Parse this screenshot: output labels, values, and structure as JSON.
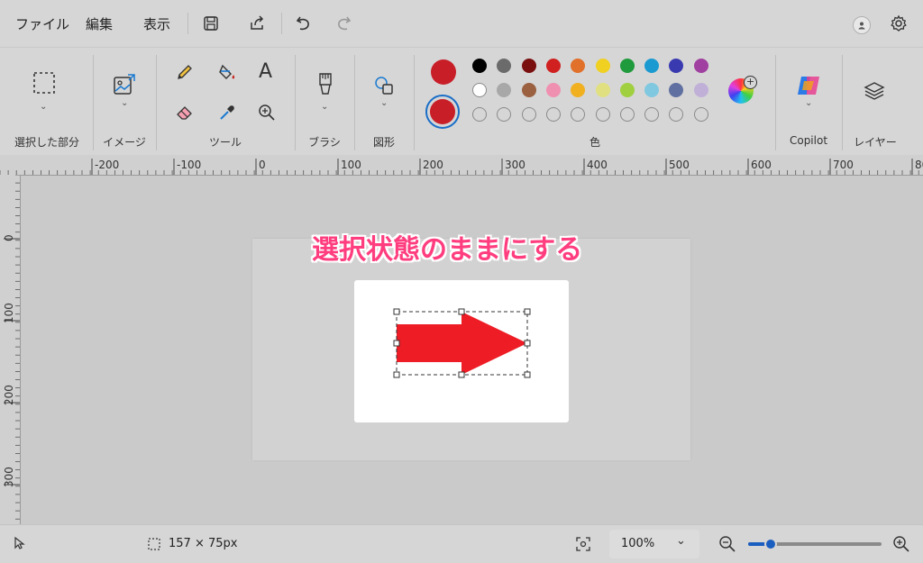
{
  "menu": {
    "items": [
      "ファイル",
      "編集",
      "表示"
    ]
  },
  "toolbar": {
    "icons": [
      "save-icon",
      "share-icon",
      "undo-icon",
      "redo-icon"
    ]
  },
  "ribbon": {
    "groups": {
      "selection": "選択した部分",
      "image": "イメージ",
      "tools": "ツール",
      "brush": "ブラシ",
      "shapes": "図形",
      "color": "色",
      "copilot": "Copilot",
      "layers": "レイヤー"
    },
    "text_tool_glyph": "A"
  },
  "colors": {
    "primary": "#c81e28",
    "secondary": "#c81e28",
    "row1": [
      "#000000",
      "#6b6b6b",
      "#7a0f0f",
      "#d02020",
      "#e0702a",
      "#f0d020",
      "#1f9a3c",
      "#1a9ad0",
      "#3a3ab0",
      "#a040a0"
    ],
    "row2": [
      "#ffffff",
      "#a8a8a8",
      "#9a6040",
      "#f090b0",
      "#f0b020",
      "#e0e080",
      "#a0d040",
      "#80c8e0",
      "#6070a0",
      "#c0b0d8"
    ]
  },
  "ruler": {
    "top_labels": [
      "-200",
      "-100",
      "0",
      "100",
      "200",
      "300",
      "400",
      "500",
      "600",
      "700",
      "80"
    ],
    "left_labels": [
      "0",
      "100",
      "200",
      "300"
    ]
  },
  "canvas": {
    "annotation": "選択状態のままにする",
    "arrow_color": "#ee1c25"
  },
  "status": {
    "selection_size": "157 × 75px",
    "zoom": "100%"
  }
}
